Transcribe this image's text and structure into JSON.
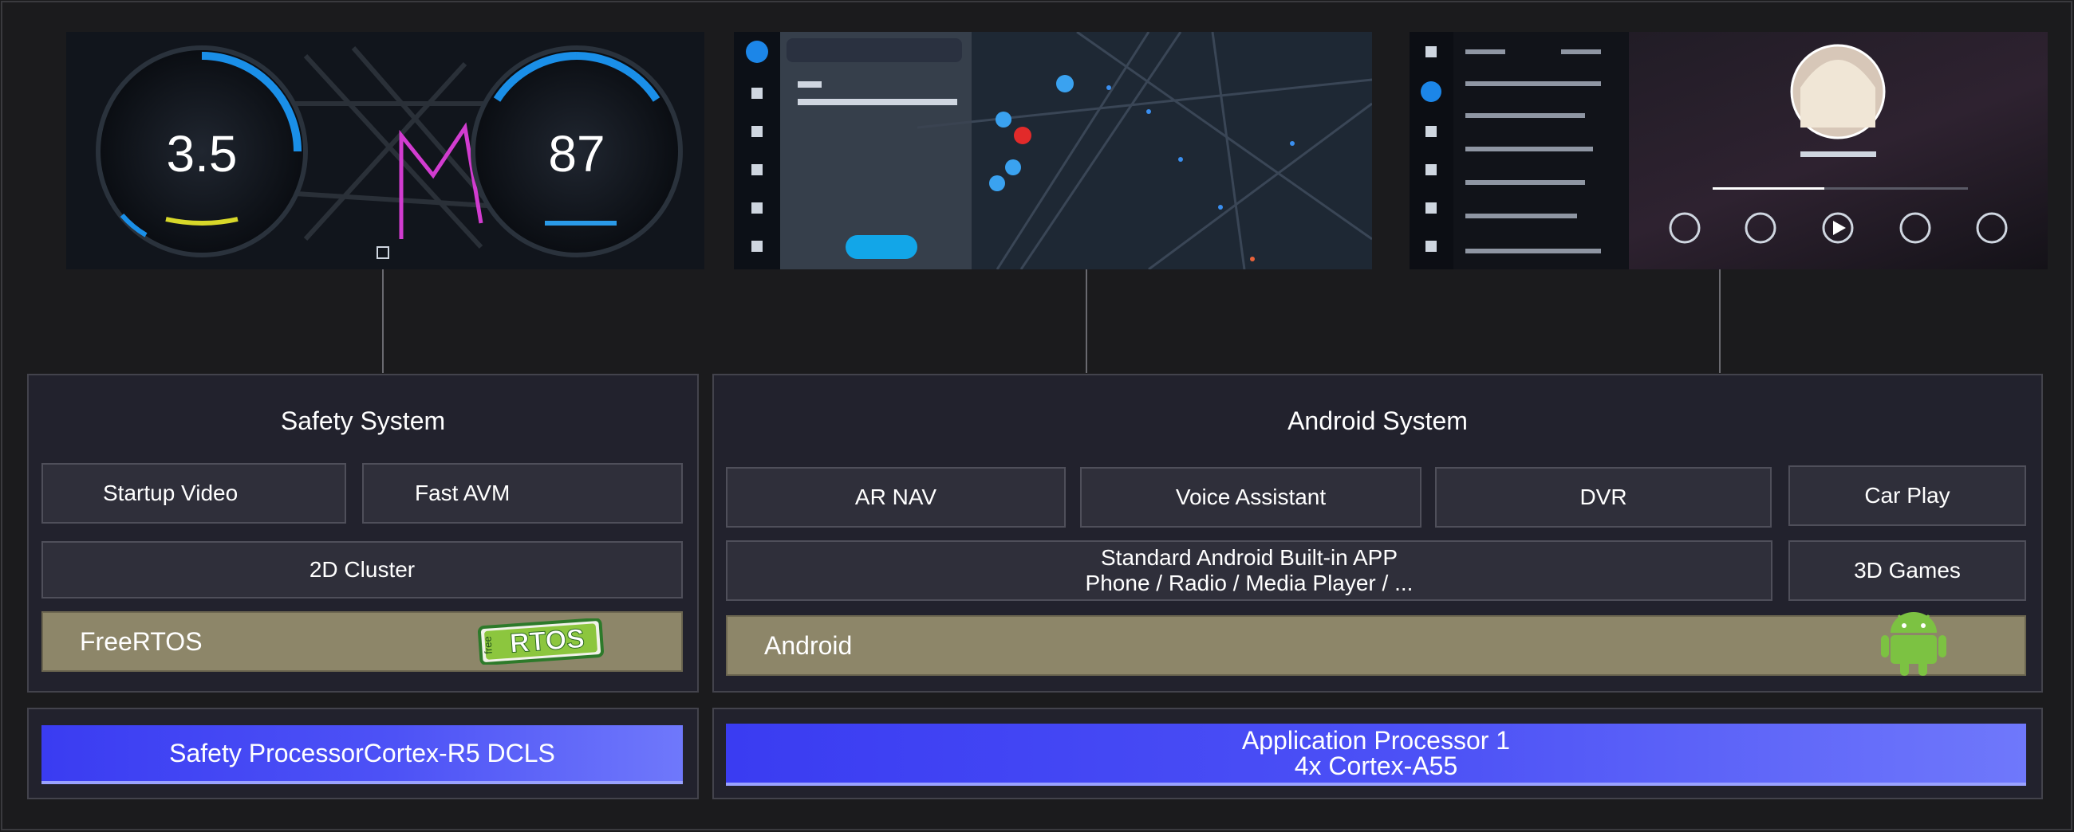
{
  "safety": {
    "title": "Safety System",
    "startup_video": "Startup Video",
    "fast_avm": "Fast AVM",
    "cluster_2d": "2D Cluster",
    "os": "FreeRTOS",
    "logo_text": "RTOS",
    "logo_small": "free",
    "processor": "Safety ProcessorCortex-R5 DCLS"
  },
  "android": {
    "title": "Android System",
    "ar_nav": "AR NAV",
    "voice_assistant": "Voice Assistant",
    "dvr": "DVR",
    "car_play": "Car Play",
    "builtin_line1": "Standard Android Built-in APP",
    "builtin_line2": "Phone / Radio / Media Player / ...",
    "games_3d": "3D Games",
    "os": "Android",
    "processor_line1": "Application Processor 1",
    "processor_line2": "4x Cortex-A55"
  },
  "screens": {
    "cluster": {
      "speed": "3.5",
      "rpm": "87"
    }
  },
  "colors": {
    "background": "#1b1b1d",
    "panel": "#22222d",
    "box": "#2f2f3a",
    "os_bar": "#8d8669",
    "processor_blue": "#3a3cf2",
    "android_green": "#7cc242"
  }
}
